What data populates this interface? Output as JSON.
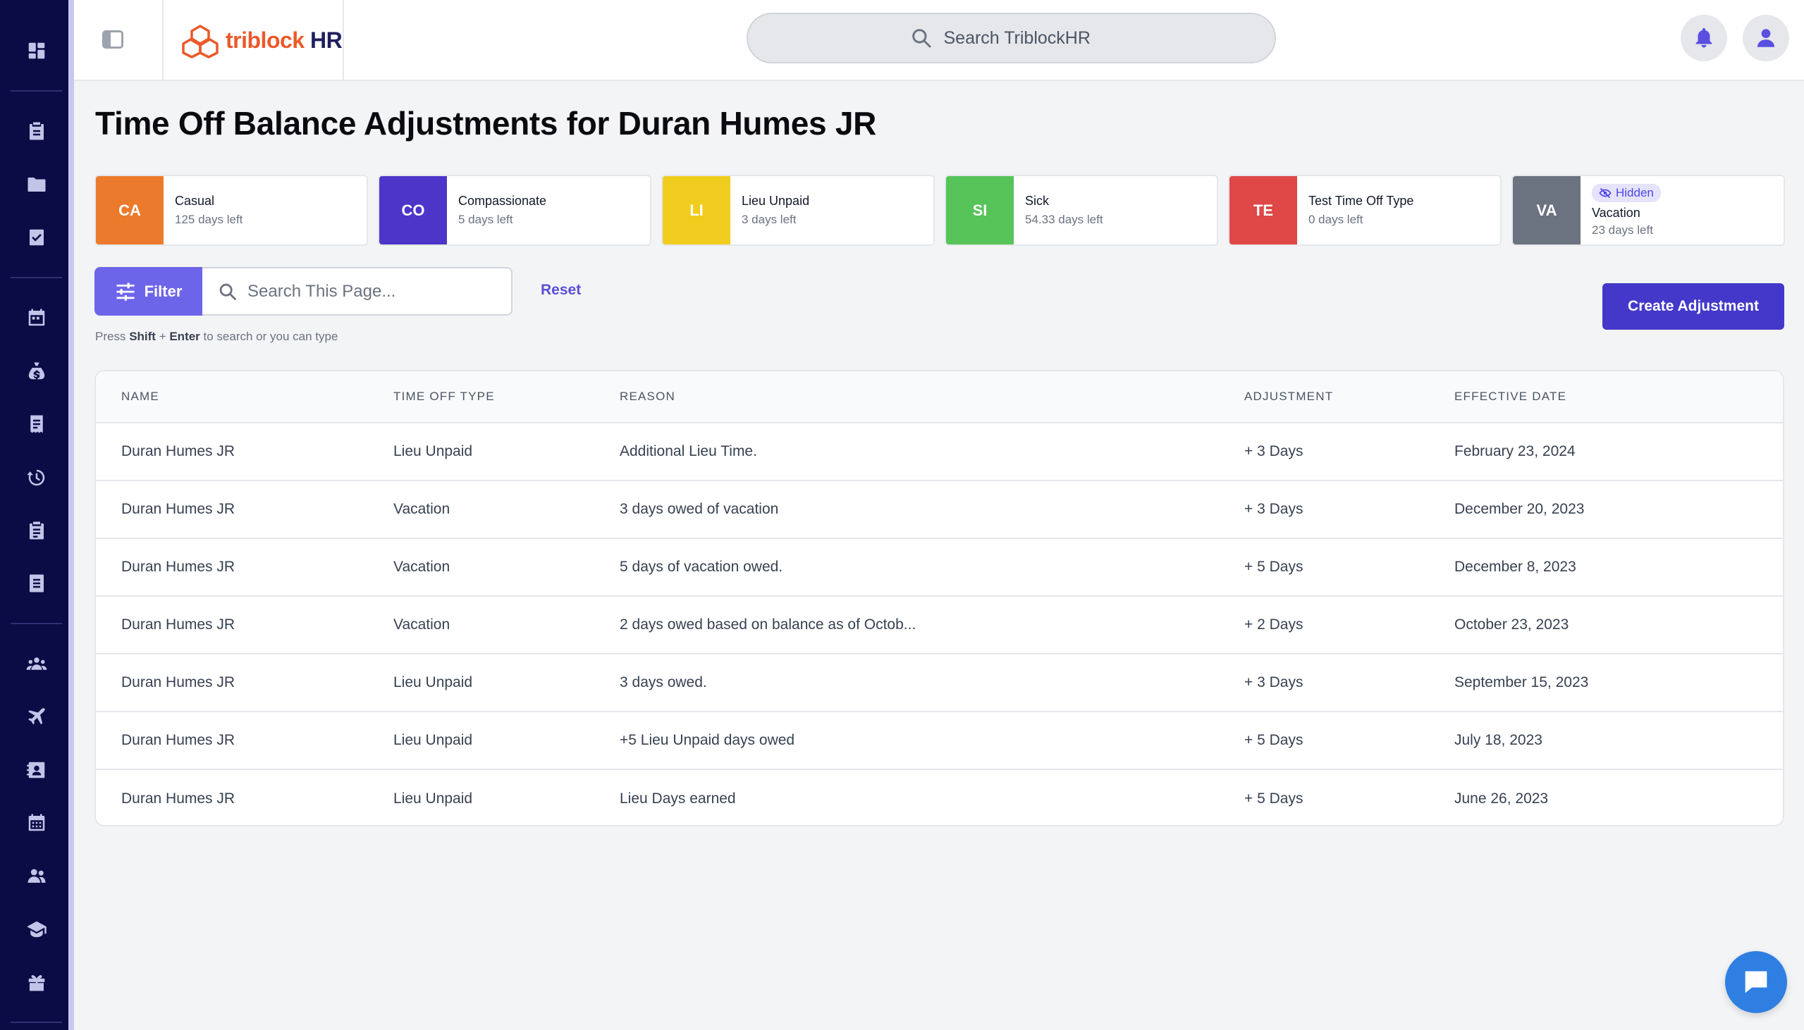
{
  "app": {
    "logo_part1": "triblock",
    "logo_part2": "HR",
    "search_placeholder": "Search TriblockHR"
  },
  "sidebar": {
    "icons": [
      "dashboard-icon",
      "clipboard-icon",
      "folder-icon",
      "checklist-icon",
      "calendar-icon",
      "money-bag-icon",
      "receipt-icon",
      "history-icon",
      "clipboard-list-icon",
      "document-icon",
      "team-icon",
      "plane-icon",
      "contact-card-icon",
      "schedule-icon",
      "users-icon",
      "graduation-icon",
      "gift-icon"
    ]
  },
  "page": {
    "title": "Time Off Balance Adjustments for Duran Humes JR"
  },
  "balances": [
    {
      "abbr": "CA",
      "name": "Casual",
      "left": "125 days left",
      "color": "#ec7a2c"
    },
    {
      "abbr": "CO",
      "name": "Compassionate",
      "left": "5 days left",
      "color": "#4d35c9"
    },
    {
      "abbr": "LI",
      "name": "Lieu Unpaid",
      "left": "3 days left",
      "color": "#f0cc1f"
    },
    {
      "abbr": "SI",
      "name": "Sick",
      "left": "54.33 days left",
      "color": "#56c458"
    },
    {
      "abbr": "TE",
      "name": "Test Time Off Type",
      "left": "0 days left",
      "color": "#e04747"
    },
    {
      "abbr": "VA",
      "name": "Vacation",
      "left": "23 days left",
      "color": "#6b7280",
      "badge": "Hidden"
    }
  ],
  "toolbar": {
    "filter_label": "Filter",
    "search_placeholder": "Search This Page...",
    "reset_label": "Reset",
    "hint_prefix": "Press ",
    "hint_key1": "Shift",
    "hint_plus": " + ",
    "hint_key2": "Enter",
    "hint_suffix": " to search or you can type",
    "create_label": "Create Adjustment"
  },
  "table": {
    "headers": [
      "NAME",
      "TIME OFF TYPE",
      "REASON",
      "ADJUSTMENT",
      "EFFECTIVE DATE"
    ],
    "rows": [
      [
        "Duran Humes JR",
        "Lieu Unpaid",
        "Additional Lieu Time.",
        "+ 3 Days",
        "February 23, 2024"
      ],
      [
        "Duran Humes JR",
        "Vacation",
        "3 days owed of vacation",
        "+ 3 Days",
        "December 20, 2023"
      ],
      [
        "Duran Humes JR",
        "Vacation",
        "5 days of vacation owed.",
        "+ 5 Days",
        "December 8, 2023"
      ],
      [
        "Duran Humes JR",
        "Vacation",
        "2 days owed based on balance as of Octob...",
        "+ 2 Days",
        "October 23, 2023"
      ],
      [
        "Duran Humes JR",
        "Lieu Unpaid",
        "3 days owed.",
        "+ 3 Days",
        "September 15, 2023"
      ],
      [
        "Duran Humes JR",
        "Lieu Unpaid",
        "+5 Lieu Unpaid days owed",
        "+ 5 Days",
        "July 18, 2023"
      ],
      [
        "Duran Humes JR",
        "Lieu Unpaid",
        "Lieu Days earned",
        "+ 5 Days",
        "June 26, 2023"
      ]
    ]
  }
}
